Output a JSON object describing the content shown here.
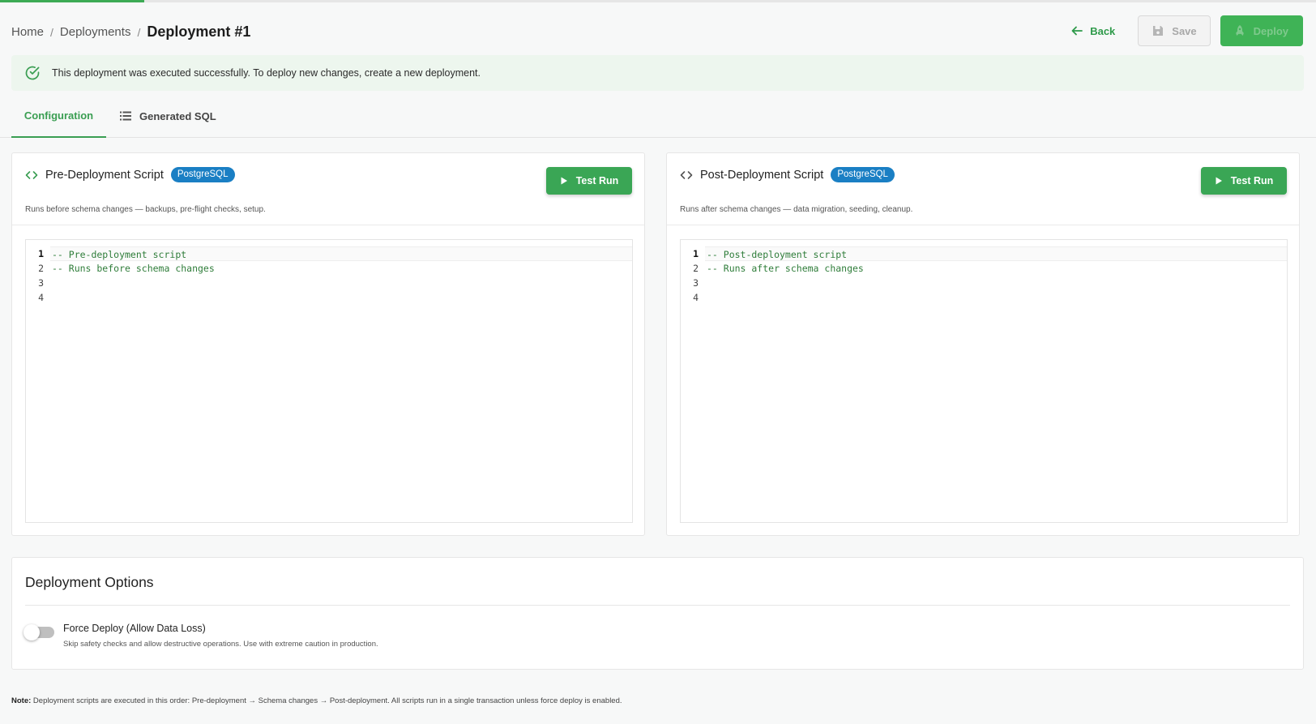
{
  "breadcrumb": {
    "home": "Home",
    "separator": "/",
    "deployments": "Deployments",
    "current": "Deployment #1"
  },
  "header": {
    "back_label": "Back",
    "save_label": "Save",
    "deploy_label": "Deploy",
    "back_icon": "arrow-left-icon",
    "save_icon": "floppy-disk-icon",
    "deploy_icon": "rocket-icon"
  },
  "alert": {
    "message": "This deployment was executed successfully. To deploy new changes, create a new deployment.",
    "icon": "check-circle-icon"
  },
  "tabs": [
    {
      "label": "Configuration",
      "active": true
    },
    {
      "label": "Generated SQL",
      "active": false,
      "icon": "list-icon"
    }
  ],
  "scripts": {
    "pre": {
      "title": "Pre-Deployment Script",
      "badge": "PostgreSQL",
      "description": "Runs before schema changes — backups, pre-flight checks, setup.",
      "test_run_label": "Test Run",
      "lines": [
        {
          "num": "1",
          "text": "-- Pre-deployment script"
        },
        {
          "num": "2",
          "text": "-- Runs before schema changes"
        },
        {
          "num": "3",
          "text": ""
        },
        {
          "num": "4",
          "text": ""
        }
      ]
    },
    "post": {
      "title": "Post-Deployment Script",
      "badge": "PostgreSQL",
      "description": "Runs after schema changes — data migration, seeding, cleanup.",
      "test_run_label": "Test Run",
      "lines": [
        {
          "num": "1",
          "text": "-- Post-deployment script"
        },
        {
          "num": "2",
          "text": "-- Runs after schema changes"
        },
        {
          "num": "3",
          "text": ""
        },
        {
          "num": "4",
          "text": ""
        }
      ]
    }
  },
  "options": {
    "title": "Deployment Options",
    "force_deploy": {
      "label": "Force Deploy (Allow Data Loss)",
      "description": "Skip safety checks and allow destructive operations. Use with extreme caution in production.",
      "enabled": false
    }
  },
  "note": {
    "label": "Note:",
    "text": " Deployment scripts are executed in this order: Pre-deployment → Schema changes → Post-deployment. All scripts run in a single transaction unless force deploy is enabled."
  },
  "colors": {
    "accent": "#3aa655",
    "badge": "#1a7fc4",
    "success_bg": "#edf6ee",
    "code_comment": "#2f7d3a"
  }
}
